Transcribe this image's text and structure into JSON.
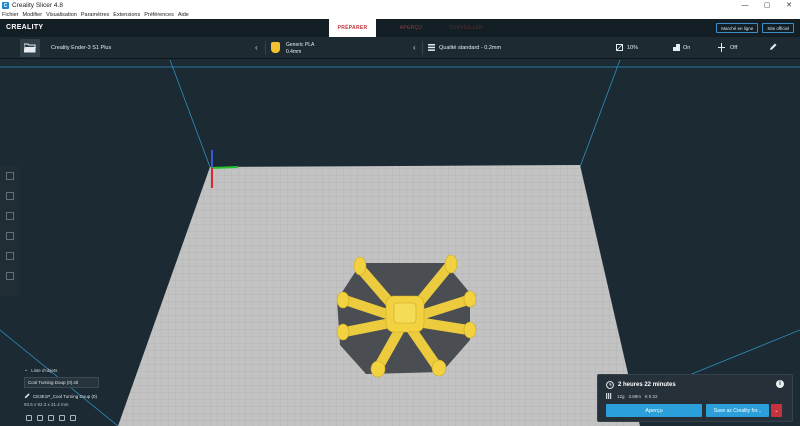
{
  "window": {
    "title": "Creality Slicer 4.8",
    "controls": [
      "—",
      "▢",
      "✕"
    ]
  },
  "menu": [
    "Fichier",
    "Modifier",
    "Visualisation",
    "Paramètres",
    "Extensions",
    "Préférences",
    "Aide"
  ],
  "header": {
    "logo": "CREALITY",
    "stages": [
      "PRÉPARER",
      "APERÇU",
      "SURVEILLER"
    ],
    "buttons": [
      "Marché en ligne",
      "Site officiel"
    ]
  },
  "toolbar": {
    "printer": "Creality Ender-3 S1 Plus",
    "material_name": "Generic PLA",
    "nozzle": "0.4mm",
    "profile": "Qualité standard - 0.2mm",
    "infill": "10%",
    "support": "On",
    "adhesion": "Off"
  },
  "object_list": {
    "title": "Liste d'objets",
    "field_value": "Cool Turning Doup (0).stl",
    "object_name": "CE3E1P_Cool Turning Doup (0)",
    "dimensions": "93.5 x 92.3 x 31.4 mm"
  },
  "print_panel": {
    "time": "2 heures 22 minutes",
    "weight": "12g",
    "length": "3.89m",
    "cost": "€ 0.22",
    "preview_button": "Aperçu",
    "save_button": "Save as Creality for..."
  },
  "colors": {
    "accent": "#c4333d",
    "primary": "#2b9fd9",
    "model": "#f2d240",
    "bed": "#c3c3c3",
    "background": "#1b2a33"
  }
}
